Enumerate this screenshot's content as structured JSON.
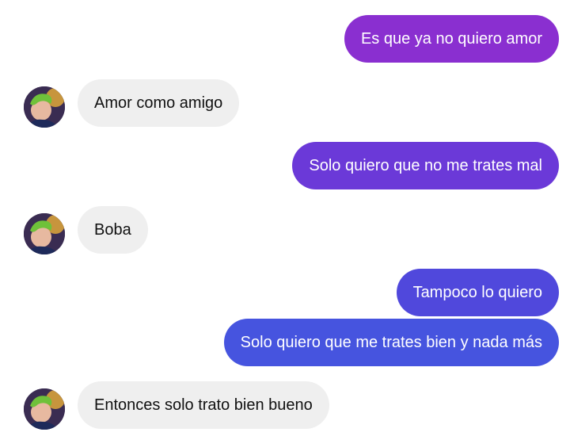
{
  "conversation": {
    "messages": [
      {
        "sender": "me",
        "text": "Es que ya no quiero amor"
      },
      {
        "sender": "other",
        "text": "Amor como amigo"
      },
      {
        "sender": "me",
        "text": "Solo quiero que no me trates mal"
      },
      {
        "sender": "other",
        "text": "Boba"
      },
      {
        "sender": "me",
        "text": "Tampoco lo quiero"
      },
      {
        "sender": "me",
        "text": "Solo quiero que me trates bien y nada más"
      },
      {
        "sender": "other",
        "text": "Entonces solo trato bien bueno"
      }
    ]
  },
  "colors": {
    "received_bubble": "#efefef",
    "sent_gradient_top": "#8a2fd0",
    "sent_gradient_bottom": "#3c5ae0"
  }
}
